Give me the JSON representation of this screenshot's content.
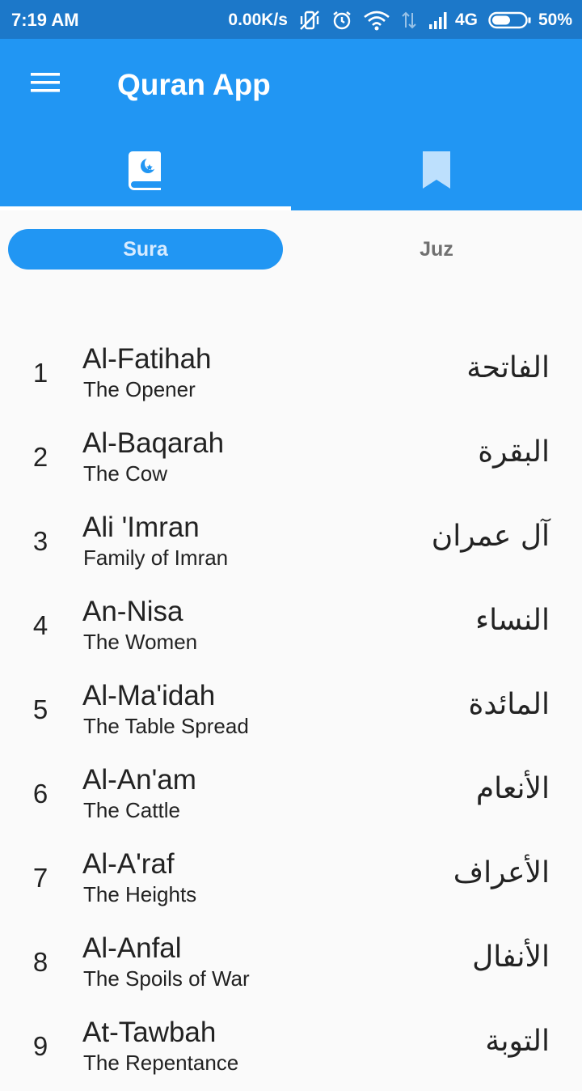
{
  "status_bar": {
    "time": "7:19 AM",
    "net_speed": "0.00K/s",
    "network": "4G",
    "battery": "50%"
  },
  "app_bar": {
    "title": "Quran App",
    "menu_icon": "hamburger-menu-icon",
    "tabs": [
      {
        "icon": "quran-book-icon",
        "selected": true
      },
      {
        "icon": "bookmark-icon",
        "selected": false
      }
    ]
  },
  "segments": {
    "sura": "Sura",
    "juz": "Juz",
    "selected": "Sura"
  },
  "colors": {
    "primary": "#2196f3",
    "status_bar": "#1c78c9",
    "background": "#fafafa"
  },
  "suras": [
    {
      "number": "1",
      "name": "Al-Fatihah",
      "translation": "The Opener",
      "arabic": "الفاتحة"
    },
    {
      "number": "2",
      "name": "Al-Baqarah",
      "translation": "The Cow",
      "arabic": "البقرة"
    },
    {
      "number": "3",
      "name": "Ali 'Imran",
      "translation": "Family of Imran",
      "arabic": "آل عمران"
    },
    {
      "number": "4",
      "name": "An-Nisa",
      "translation": "The Women",
      "arabic": "النساء"
    },
    {
      "number": "5",
      "name": "Al-Ma'idah",
      "translation": "The Table Spread",
      "arabic": "المائدة"
    },
    {
      "number": "6",
      "name": "Al-An'am",
      "translation": "The Cattle",
      "arabic": "الأنعام"
    },
    {
      "number": "7",
      "name": "Al-A'raf",
      "translation": "The Heights",
      "arabic": "الأعراف"
    },
    {
      "number": "8",
      "name": "Al-Anfal",
      "translation": "The Spoils of War",
      "arabic": "الأنفال"
    },
    {
      "number": "9",
      "name": "At-Tawbah",
      "translation": "The Repentance",
      "arabic": "التوبة"
    }
  ]
}
